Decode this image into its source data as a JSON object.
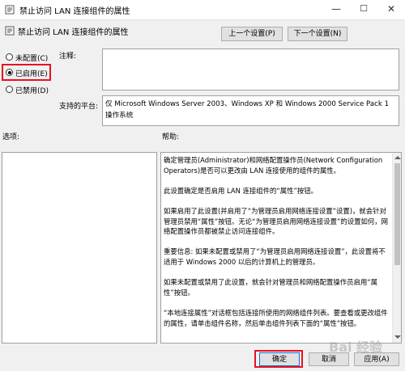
{
  "window": {
    "title": "禁止访问 LAN 连接组件的属性",
    "minimize": "—",
    "maximize": "☐",
    "close": "✕"
  },
  "header": {
    "title": "禁止访问 LAN 连接组件的属性",
    "prev_button": "上一个设置(P)",
    "next_button": "下一个设置(N)"
  },
  "state": {
    "options": [
      {
        "label": "未配置(C)",
        "selected": false
      },
      {
        "label": "已启用(E)",
        "selected": true
      },
      {
        "label": "已禁用(D)",
        "selected": false
      }
    ]
  },
  "comment": {
    "label": "注释:",
    "value": ""
  },
  "supported": {
    "label": "支持的平台:",
    "value": "仅 Microsoft Windows Server 2003、Windows XP 和 Windows 2000 Service Pack 1 操作系统"
  },
  "options_label": "选项:",
  "help": {
    "label": "帮助:",
    "paragraphs": [
      "确定管理员(Administrator)和网络配置操作员(Network Configuration Operators)是否可以更改由 LAN 连接使用的组件的属性。",
      "此设置确定是否启用 LAN 连接组件的“属性”按钮。",
      "如果启用了此设置(并启用了“为管理员启用网络连接设置”设置)，就会针对管理员禁用“属性”按钮。无论“为管理员启用网络连接设置”的设置如何，网络配置操作员都被禁止访问连接组件。",
      "重要信息: 如果未配置或禁用了“为管理员启用网络连接设置”，此设置将不适用于 Windows 2000 以后的计算机上的管理员。",
      "如果未配置或禁用了此设置，就会针对管理员和网络配置操作员启用“属性”按钮。",
      "“本地连接属性”对话框包括连接所使用的网络组件列表。要查看或更改组件的属性，请单击组件名称，然后单击组件列表下面的“属性”按钮。"
    ]
  },
  "footer": {
    "ok": "确定",
    "cancel": "取消",
    "apply": "应用(A)"
  },
  "watermark": "Bai 经验"
}
